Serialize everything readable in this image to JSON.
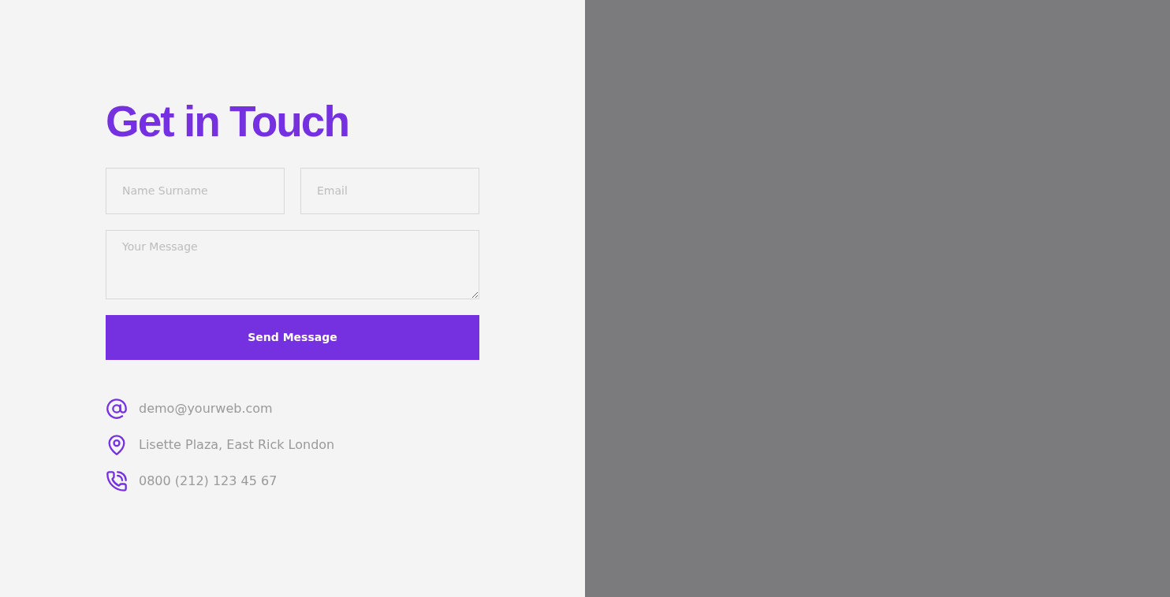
{
  "heading": "Get in Touch",
  "form": {
    "name": {
      "placeholder": "Name Surname"
    },
    "email": {
      "placeholder": "Email"
    },
    "message": {
      "placeholder": "Your Message"
    },
    "submit": "Send Message"
  },
  "contacts": [
    {
      "kind": "email",
      "text": "demo@yourweb.com"
    },
    {
      "kind": "location",
      "text": "Lisette Plaza, East Rick London"
    },
    {
      "kind": "phone",
      "text": "0800 (212) 123 45 67"
    }
  ]
}
